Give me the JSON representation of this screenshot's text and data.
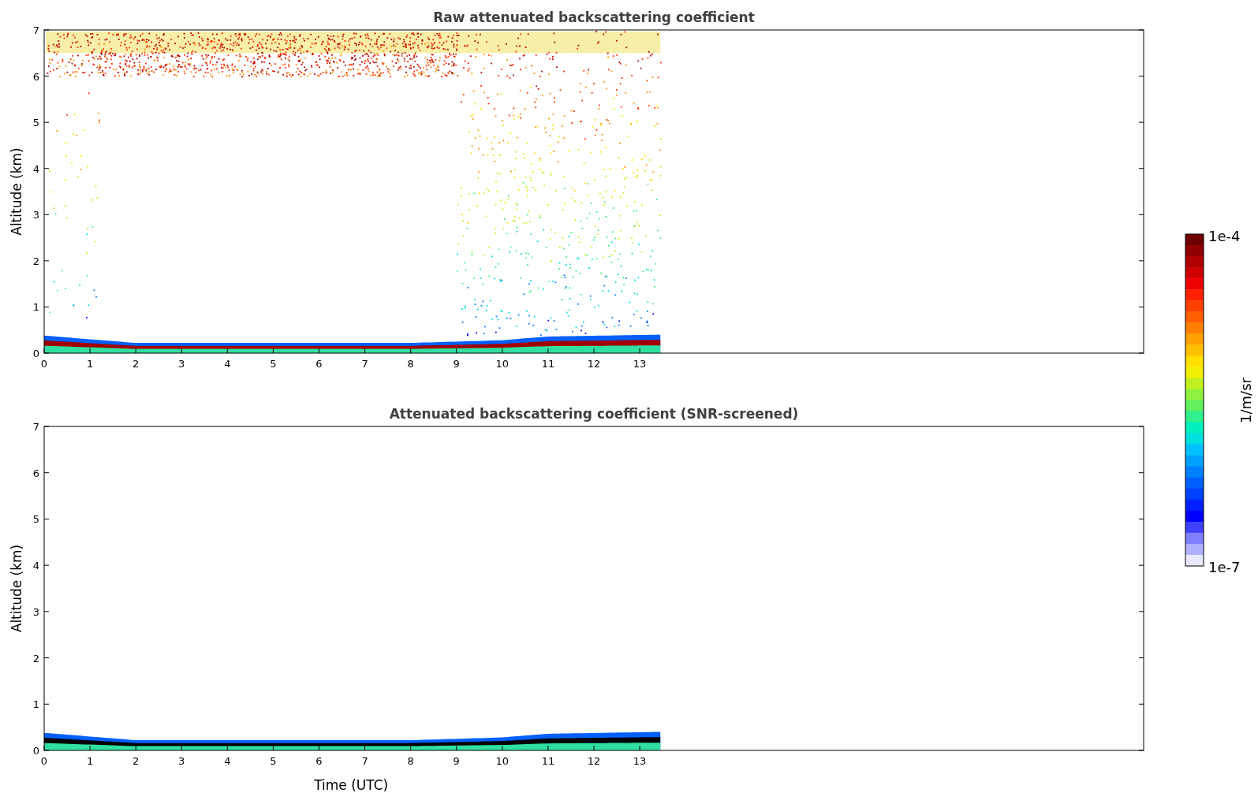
{
  "panels": [
    {
      "title": "Raw attenuated backscattering coefficient",
      "ylabel": "Altitude (km)",
      "kind": "raw",
      "yticks": [
        "7",
        "6",
        "5",
        "4",
        "3",
        "2",
        "1",
        "0"
      ],
      "xticks": [
        "0",
        "1",
        "2",
        "3",
        "4",
        "5",
        "6",
        "7",
        "8",
        "9",
        "10",
        "11",
        "12",
        "13"
      ]
    },
    {
      "title": "Attenuated backscattering coefficient (SNR-screened)",
      "ylabel": "Altitude (km)",
      "kind": "screened",
      "yticks": [
        "7",
        "6",
        "5",
        "4",
        "3",
        "2",
        "1",
        "0"
      ],
      "xticks": [
        "0",
        "1",
        "2",
        "3",
        "4",
        "5",
        "6",
        "7",
        "8",
        "9",
        "10",
        "11",
        "12",
        "13"
      ],
      "xlabel": "Time (UTC)"
    }
  ],
  "colorbar": {
    "max_label": "1e-4",
    "min_label": "1e-7",
    "unit_label": "1/m/sr"
  }
}
